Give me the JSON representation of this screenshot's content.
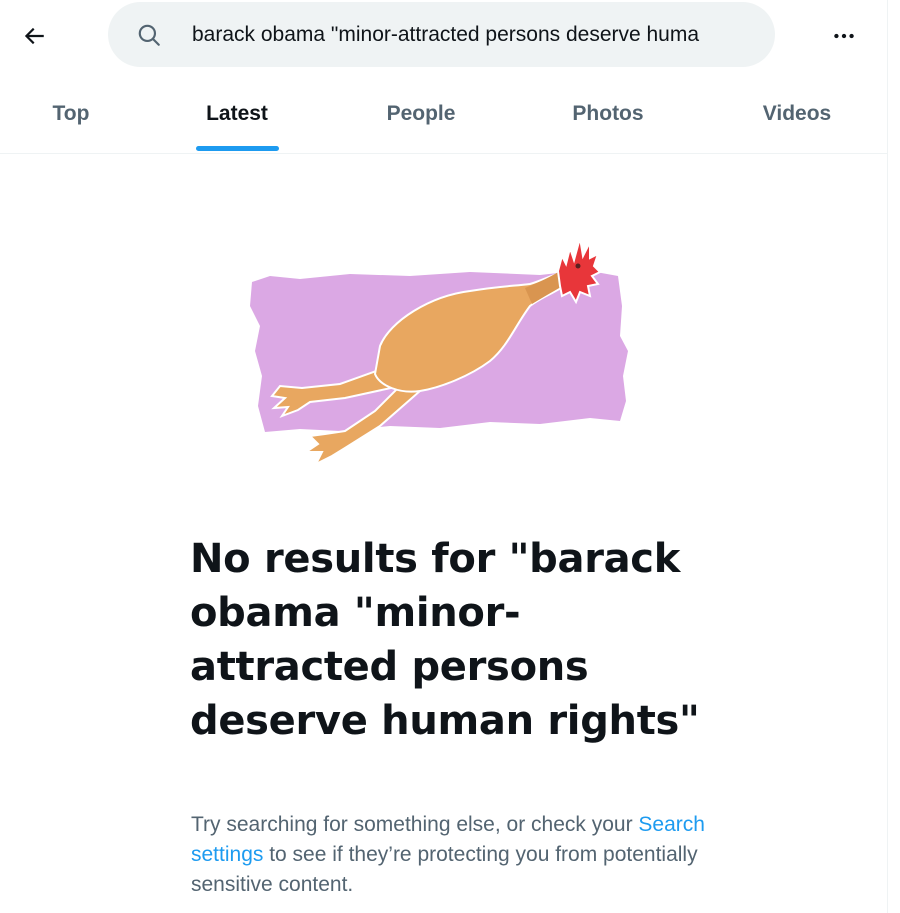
{
  "search": {
    "query": "barack obama \"minor-attracted persons deserve huma"
  },
  "tabs": [
    {
      "label": "Top"
    },
    {
      "label": "Latest"
    },
    {
      "label": "People"
    },
    {
      "label": "Photos"
    },
    {
      "label": "Videos"
    }
  ],
  "active_tab": "Latest",
  "empty_state": {
    "title": "No results for \"barack obama \"minor-attracted persons deserve human rights\"",
    "desc_before": "Try searching for something else, or check your ",
    "desc_link": "Search settings",
    "desc_after": " to see if they’re protecting you from potentially sensitive content."
  },
  "colors": {
    "accent": "#1d9bf0",
    "text_primary": "#0f1419",
    "text_secondary": "#536471",
    "search_bg": "#eff3f4",
    "illustration_bg": "#dba8e4",
    "chicken_body": "#e8a760",
    "chicken_comb": "#e8363a"
  },
  "icons": {
    "back": "arrow-left-icon",
    "search": "search-icon",
    "more": "more-horizontal-icon",
    "illustration": "rubber-chicken-illustration"
  }
}
